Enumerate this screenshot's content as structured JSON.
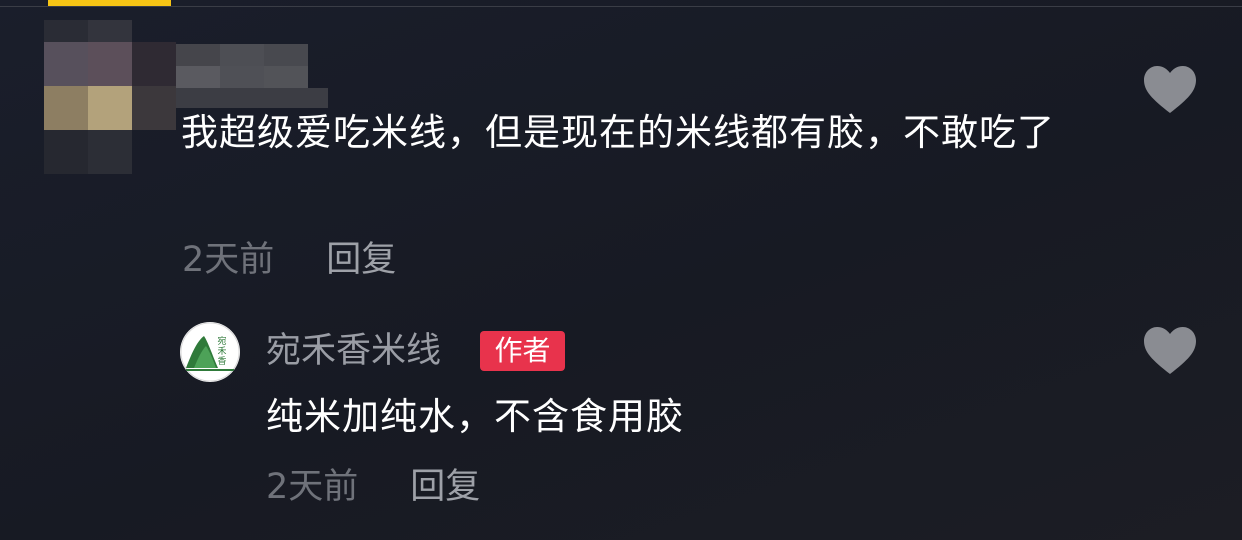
{
  "header": {
    "active_tab_color": "#f7c515"
  },
  "comment": {
    "user_name": "",
    "text": "我超级爱吃米线，但是现在的米线都有胶，不敢吃了",
    "time": "2天前",
    "reply_label": "回复",
    "like_icon": "heart-icon"
  },
  "reply": {
    "user_name": "宛禾香米线",
    "badge": "作者",
    "badge_color": "#e8334c",
    "avatar_logo_text": "宛禾香",
    "text": "纯米加纯水，不含食用胶",
    "time": "2天前",
    "reply_label": "回复",
    "like_icon": "heart-icon"
  }
}
